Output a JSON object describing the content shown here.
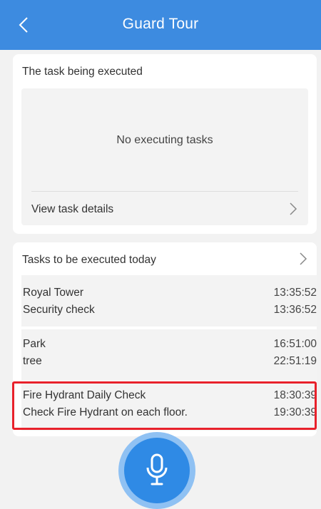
{
  "header": {
    "title": "Guard Tour"
  },
  "executing": {
    "title": "The task being executed",
    "empty_text": "No executing tasks",
    "view_details_label": "View task details"
  },
  "today": {
    "title": "Tasks to be executed today",
    "groups": [
      {
        "rows": [
          {
            "name": "Royal Tower",
            "time": "13:35:52"
          },
          {
            "name": "Security check",
            "time": "13:36:52"
          }
        ]
      },
      {
        "rows": [
          {
            "name": "Park",
            "time": "16:51:00"
          },
          {
            "name": "tree",
            "time": "22:51:19"
          }
        ]
      },
      {
        "rows": [
          {
            "name": "Fire Hydrant Daily Check",
            "time": "18:30:39"
          },
          {
            "name": "Check Fire Hydrant on each floor.",
            "time": "19:30:39"
          }
        ]
      }
    ]
  },
  "icons": {
    "back": "chevron-left-icon",
    "chevron": "chevron-right-icon",
    "mic": "microphone-icon"
  },
  "colors": {
    "header": "#3d8be0",
    "highlight": "#e8212b",
    "mic": "#2f8ae5"
  }
}
